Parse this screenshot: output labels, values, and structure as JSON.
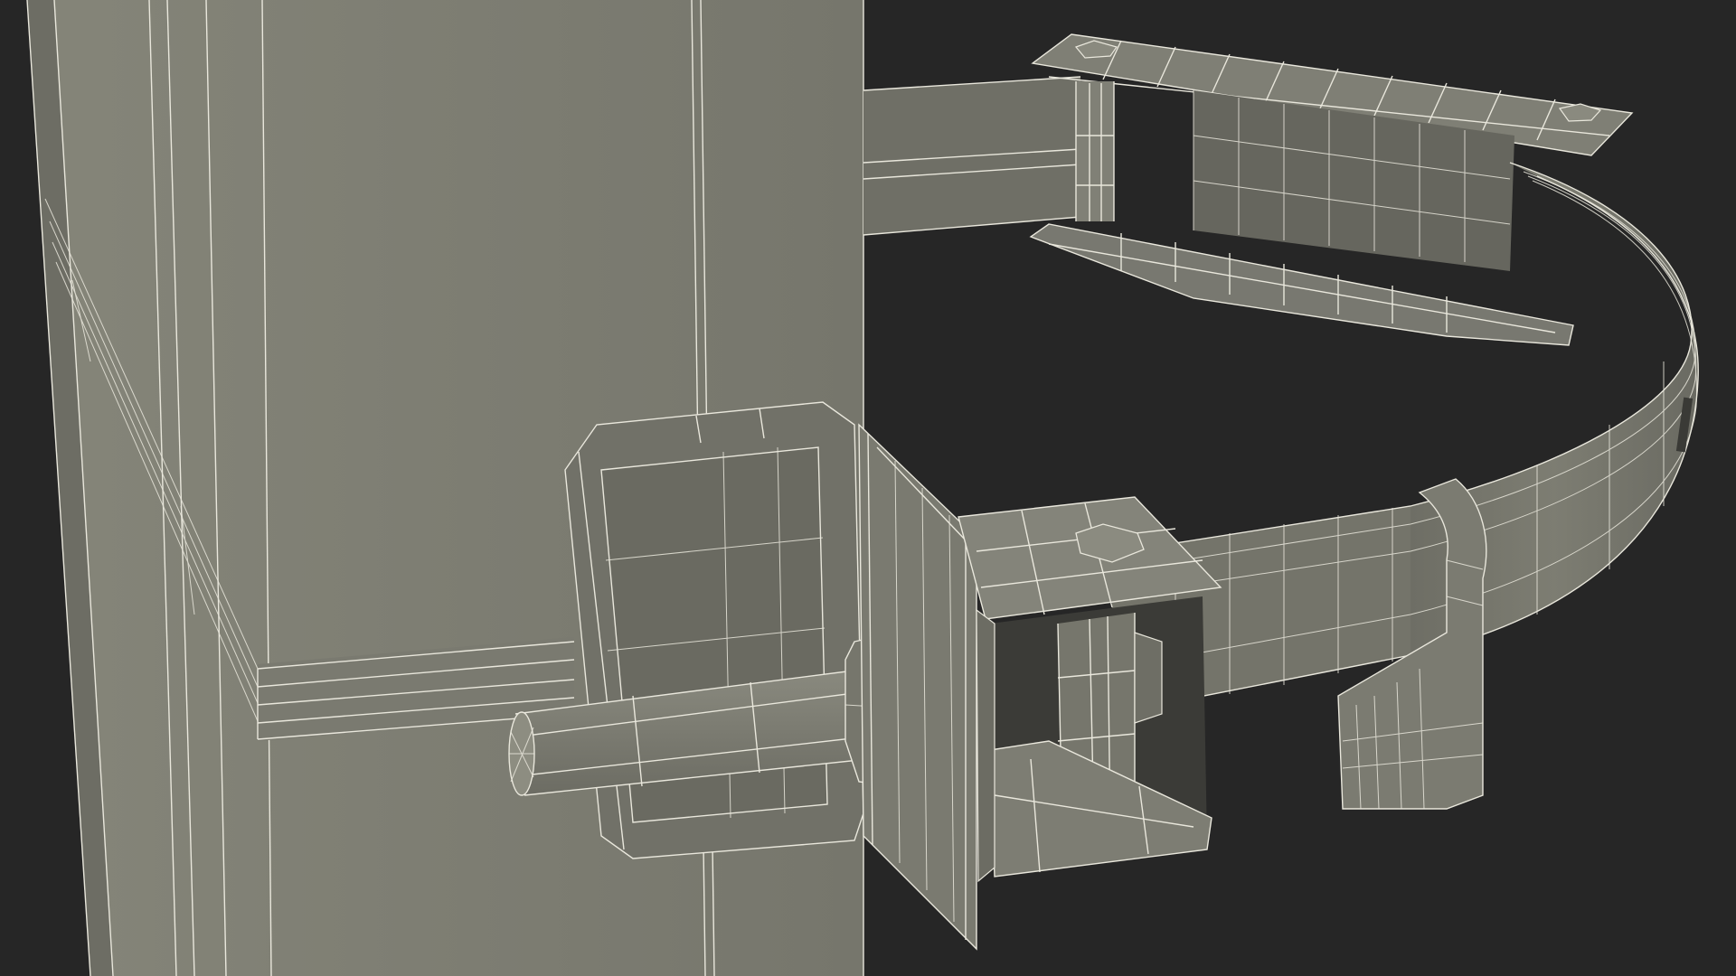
{
  "scene": {
    "subject": "wireframe-render",
    "background_color": "#262626",
    "surface_color": "#7b7b71",
    "surface_dark_color": "#5f5f57",
    "surface_light_color": "#85857b",
    "wire_color": "#e9e7dc"
  }
}
